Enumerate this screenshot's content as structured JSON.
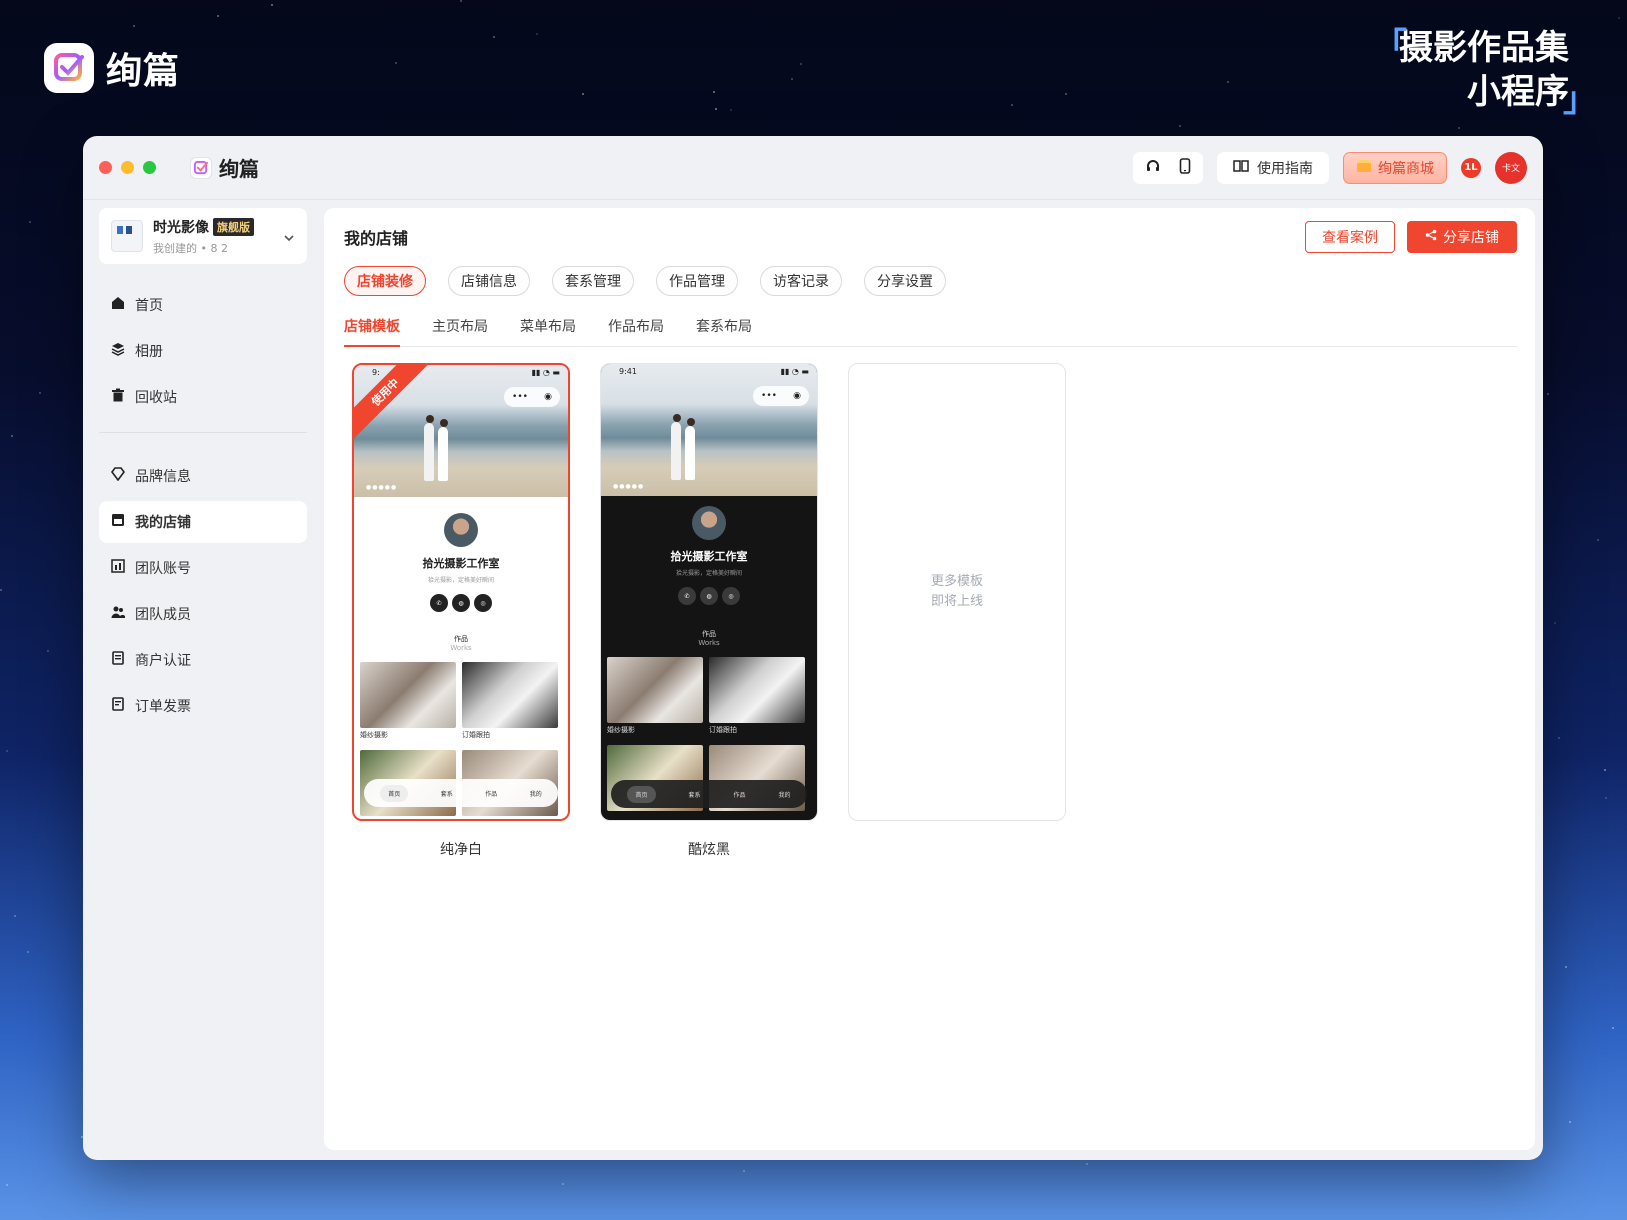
{
  "brand": {
    "name": "绚篇"
  },
  "headline": {
    "line1": "摄影作品集",
    "line2": "小程序",
    "open_quote": "「",
    "close_quote": "」"
  },
  "titlebar": {
    "app_name": "绚篇",
    "guide_label": "使用指南",
    "shop_label": "绚篇商城",
    "notif_badge": "1L",
    "avatar_text": "卡文",
    "dot_colors": [
      "#fe5f57",
      "#febc2e",
      "#28c840"
    ]
  },
  "sidebar": {
    "store": {
      "name": "时光影像",
      "tag": "旗舰版",
      "sub": "我创建的 • 8 2"
    },
    "items_top": [
      {
        "label": "首页",
        "icon": "home-icon"
      },
      {
        "label": "相册",
        "icon": "layers-icon"
      },
      {
        "label": "回收站",
        "icon": "trash-icon"
      }
    ],
    "items_bottom": [
      {
        "label": "品牌信息",
        "icon": "diamond-icon"
      },
      {
        "label": "我的店铺",
        "icon": "store-icon",
        "active": true
      },
      {
        "label": "团队账号",
        "icon": "chart-icon"
      },
      {
        "label": "团队成员",
        "icon": "team-icon"
      },
      {
        "label": "商户认证",
        "icon": "doc-icon"
      },
      {
        "label": "订单发票",
        "icon": "invoice-icon"
      }
    ]
  },
  "main": {
    "title": "我的店铺",
    "view_cases_label": "查看案例",
    "share_label": "分享店铺",
    "pills": [
      "店铺装修",
      "店铺信息",
      "套系管理",
      "作品管理",
      "访客记录",
      "分享设置"
    ],
    "subtabs": [
      "店铺模板",
      "主页布局",
      "菜单布局",
      "作品布局",
      "套系布局"
    ],
    "templates": [
      {
        "name": "纯净白",
        "ribbon": "使用中",
        "time": "9:",
        "studio": "拾光摄影工作室",
        "slogan": "拾光摄影，定格美好瞬间",
        "works": "作品",
        "works_en": "Works",
        "captions": [
          "婚纱摄影",
          "订婚跟拍"
        ],
        "tabs": [
          "首页",
          "套系",
          "作品",
          "我的"
        ]
      },
      {
        "name": "酷炫黑",
        "time": "9:41",
        "studio": "拾光摄影工作室",
        "slogan": "拾光摄影，定格美好瞬间",
        "works": "作品",
        "works_en": "Works",
        "captions": [
          "婚纱摄影",
          "订婚跟拍"
        ],
        "tabs": [
          "首页",
          "套系",
          "作品",
          "我的"
        ]
      }
    ],
    "placeholder": {
      "line1": "更多模板",
      "line2": "即将上线"
    }
  },
  "colors": {
    "accent": "#f0452e"
  }
}
